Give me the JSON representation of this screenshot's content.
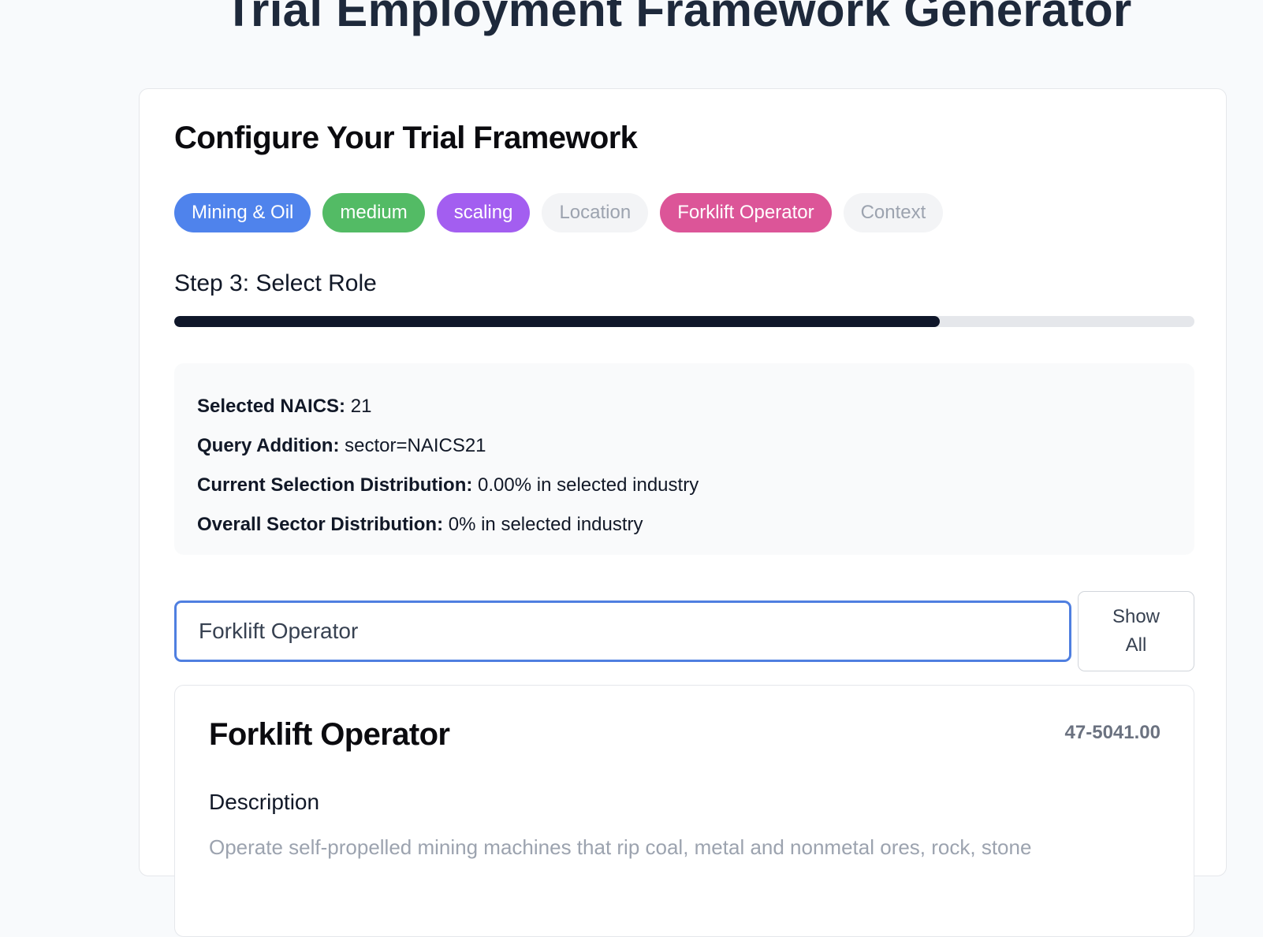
{
  "header": {
    "title": "Trial Employment Framework Generator"
  },
  "card": {
    "title": "Configure Your Trial Framework",
    "chips": [
      {
        "label": "Mining & Oil",
        "state": "filled",
        "color": "#4f83ec"
      },
      {
        "label": "medium",
        "state": "filled",
        "color": "#53bb65"
      },
      {
        "label": "scaling",
        "state": "filled",
        "color": "#a35ef0"
      },
      {
        "label": "Location",
        "state": "empty",
        "color": "#f3f4f6"
      },
      {
        "label": "Forklift Operator",
        "state": "filled",
        "color": "#dc5598"
      },
      {
        "label": "Context",
        "state": "empty",
        "color": "#f3f4f6"
      }
    ],
    "step_label": "Step 3: Select Role",
    "progress_fraction": 0.75,
    "info": {
      "naics_key": "Selected NAICS:",
      "naics_value": "21",
      "query_key": "Query Addition:",
      "query_value": "sector=NAICS21",
      "current_key": "Current Selection Distribution:",
      "current_value": "0.00% in selected industry",
      "overall_key": "Overall Sector Distribution:",
      "overall_value": "0% in selected industry"
    },
    "search": {
      "value": "Forklift Operator",
      "show_all_line1": "Show",
      "show_all_line2": "All"
    },
    "role": {
      "title": "Forklift Operator",
      "code": "47-5041.00",
      "description_heading": "Description",
      "description": "Operate self-propelled mining machines that rip coal, metal and nonmetal ores, rock, stone"
    }
  },
  "colors": {
    "accent": "#4f7fe0",
    "progress": "#0f172a"
  }
}
